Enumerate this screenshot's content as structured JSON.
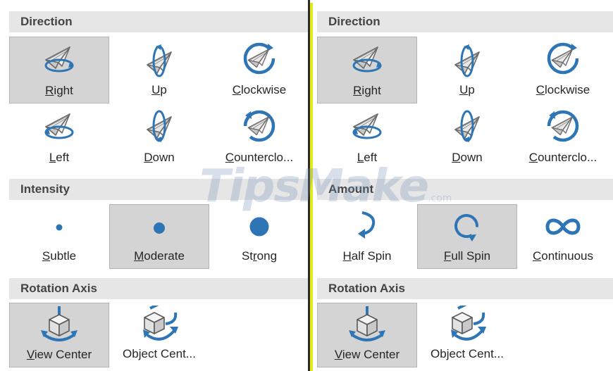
{
  "left_panel": {
    "direction": {
      "title": "Direction",
      "options": [
        {
          "mn": "R",
          "rest": "ight",
          "icon": "spin-right-icon",
          "selected": true
        },
        {
          "mn": "U",
          "rest": "p",
          "icon": "spin-up-icon",
          "selected": false
        },
        {
          "mn": "C",
          "rest": "lockwise",
          "icon": "spin-clockwise-icon",
          "selected": false
        },
        {
          "mn": "L",
          "rest": "eft",
          "icon": "spin-left-icon",
          "selected": false
        },
        {
          "mn": "D",
          "rest": "own",
          "icon": "spin-down-icon",
          "selected": false
        },
        {
          "mn": "C",
          "rest": "ounterclo...",
          "icon": "spin-counterclockwise-icon",
          "selected": false
        }
      ]
    },
    "intensity": {
      "title": "Intensity",
      "options": [
        {
          "mn": "S",
          "rest": "ubtle",
          "icon": "dot-small-icon",
          "selected": false
        },
        {
          "mn": "M",
          "rest": "oderate",
          "icon": "dot-medium-icon",
          "selected": true
        },
        {
          "pre": "St",
          "mn": "r",
          "rest": "ong",
          "icon": "dot-large-icon",
          "selected": false
        }
      ]
    },
    "rotation_axis": {
      "title": "Rotation Axis",
      "options": [
        {
          "mn": "V",
          "rest": "iew Center",
          "icon": "view-center-icon",
          "selected": true
        },
        {
          "mn": "",
          "rest": "Object Cent...",
          "icon": "object-center-icon",
          "selected": false
        }
      ]
    }
  },
  "right_panel": {
    "direction": {
      "title": "Direction",
      "options": [
        {
          "mn": "R",
          "rest": "ight",
          "icon": "spin-right-icon",
          "selected": true
        },
        {
          "mn": "U",
          "rest": "p",
          "icon": "spin-up-icon",
          "selected": false
        },
        {
          "mn": "C",
          "rest": "lockwise",
          "icon": "spin-clockwise-icon",
          "selected": false
        },
        {
          "mn": "L",
          "rest": "eft",
          "icon": "spin-left-icon",
          "selected": false
        },
        {
          "mn": "D",
          "rest": "own",
          "icon": "spin-down-icon",
          "selected": false
        },
        {
          "mn": "C",
          "rest": "ounterclo...",
          "icon": "spin-counterclockwise-icon",
          "selected": false
        }
      ]
    },
    "amount": {
      "title": "Amount",
      "options": [
        {
          "mn": "H",
          "rest": "alf Spin",
          "icon": "half-spin-icon",
          "selected": false
        },
        {
          "mn": "F",
          "rest": "ull Spin",
          "icon": "full-spin-icon",
          "selected": true
        },
        {
          "mn": "C",
          "rest": "ontinuous",
          "icon": "infinity-icon",
          "selected": false
        }
      ]
    },
    "rotation_axis": {
      "title": "Rotation Axis",
      "options": [
        {
          "mn": "V",
          "rest": "iew Center",
          "icon": "view-center-icon",
          "selected": true
        },
        {
          "mn": "",
          "rest": "Object Cent...",
          "icon": "object-center-icon",
          "selected": false
        }
      ]
    }
  },
  "watermark": {
    "main": "TipsMake",
    "sub": ".com"
  },
  "colors": {
    "accent": "#2e75b6",
    "selected_bg": "#d4d4d4",
    "header_bg": "#e6e6e6",
    "divider": "#e3ea1a"
  }
}
